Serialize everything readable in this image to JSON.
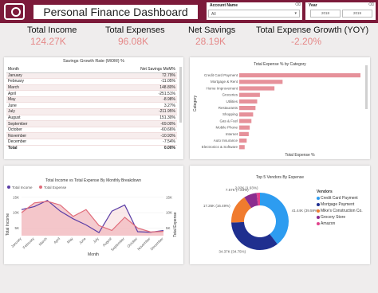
{
  "header": {
    "title": "Personal Finance Dashboard",
    "account_label": "Account Name",
    "account_value": "All",
    "year_label": "Year",
    "year_from": "2018",
    "year_to": "2019",
    "erase_glyph": "⌫",
    "logo_icon": "wallet-icon"
  },
  "kpis": [
    {
      "label": "Total Income",
      "value": "124.27K"
    },
    {
      "label": "Total Expenses",
      "value": "96.08K"
    },
    {
      "label": "Net Savings",
      "value": "28.19K"
    },
    {
      "label": "Total Expense Growth (YOY)",
      "value": "-2.20%"
    }
  ],
  "savings_table": {
    "title": "Savings Growth Rate (MOM) %",
    "col_month": "Month",
    "col_value": "Net Savings MoM%",
    "rows": [
      {
        "month": "January",
        "value": "72.79%"
      },
      {
        "month": "February",
        "value": "-11.05%"
      },
      {
        "month": "March",
        "value": "148.80%"
      },
      {
        "month": "April",
        "value": "-251.51%"
      },
      {
        "month": "May",
        "value": "-8.98%"
      },
      {
        "month": "June",
        "value": "3.27%"
      },
      {
        "month": "July",
        "value": "-211.95%"
      },
      {
        "month": "August",
        "value": "151.30%"
      },
      {
        "month": "September",
        "value": "-69.00%"
      },
      {
        "month": "October",
        "value": "-60.66%"
      },
      {
        "month": "November",
        "value": "-10.93%"
      },
      {
        "month": "December",
        "value": "-7.54%"
      }
    ],
    "total_label": "Total",
    "total_value": "0.00%"
  },
  "chart_data": [
    {
      "type": "bar",
      "title": "Total Expense % by Category",
      "xlabel": "Total Expense %",
      "ylabel": "Category",
      "categories": [
        "Credit Card Payment",
        "Mortgage & Rent",
        "Home Improvement",
        "Groceries",
        "Utilities",
        "Restaurants",
        "Shopping",
        "Gas & Fuel",
        "Mobile Phone",
        "Internet",
        "Auto Insurance",
        "Electronics & Software"
      ],
      "values": [
        35.8,
        12.8,
        10.4,
        6.1,
        5.3,
        4.8,
        4.1,
        3.6,
        3.1,
        2.8,
        2.2,
        1.6
      ],
      "bar_color": "#e6919a"
    },
    {
      "type": "area",
      "title": "Total Income vs Total Expense By Monthly Breakdown",
      "xlabel": "Month",
      "ylabel": "Total Income",
      "ylabel_right": "Total Expense",
      "categories": [
        "January",
        "February",
        "March",
        "April",
        "May",
        "June",
        "July",
        "August",
        "September",
        "October",
        "November",
        "December"
      ],
      "yticks_left": [
        "15K",
        "10K",
        "5K"
      ],
      "yticks_right": [
        "15K",
        "10K",
        "5K"
      ],
      "ylim": [
        2500,
        16000
      ],
      "series": [
        {
          "name": "Total Income",
          "color": "#5b3ea6",
          "values": [
            11000,
            12000,
            14000,
            10500,
            8000,
            6000,
            3500,
            10500,
            12500,
            3800,
            3600,
            4200
          ]
        },
        {
          "name": "Total Expense",
          "color": "#e06c7a",
          "values": [
            10000,
            13200,
            13700,
            12500,
            8800,
            11000,
            5800,
            4200,
            8500,
            5000,
            3700,
            3900
          ]
        }
      ]
    },
    {
      "type": "pie",
      "title": "Top 5 Vendors By Expense",
      "legend_title": "Vendors",
      "categories": [
        "Credit Card Payment",
        "Mortgage Payment",
        "Mike's Construction Co.",
        "Grocery Store",
        "Amazon"
      ],
      "values": [
        41.44,
        36.37,
        17.26,
        7.57,
        2.02
      ],
      "labels": [
        "41.44K",
        "34.37K",
        "17.26K",
        "7.57K",
        "2.02K"
      ],
      "colors": [
        "#2d9cf0",
        "#1f2f8f",
        "#f07b2e",
        "#8a2c8f",
        "#e0428c"
      ]
    }
  ]
}
